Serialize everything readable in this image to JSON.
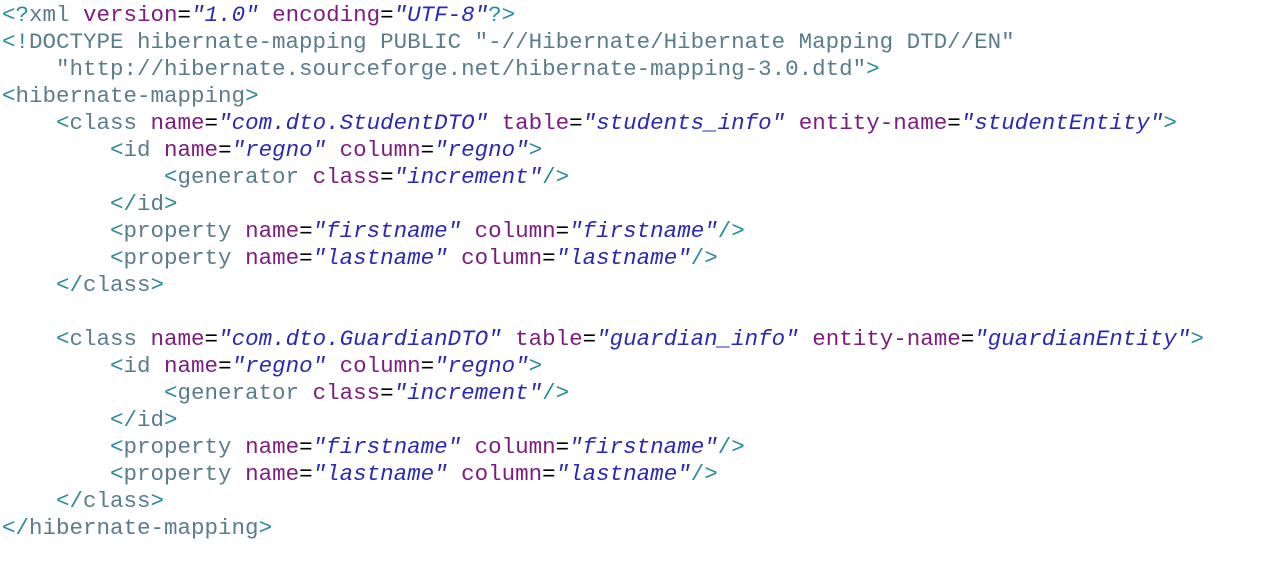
{
  "colors": {
    "background": "#ffffff",
    "bracket": "#2a8b9a",
    "tag": "#5a7d8c",
    "attr": "#7d1b7e",
    "string": "#2929b8",
    "text": "#000000"
  },
  "lines": [
    [
      {
        "t": "<?",
        "c": "bracket"
      },
      {
        "t": "xml ",
        "c": "tag"
      },
      {
        "t": "version",
        "c": "attr"
      },
      {
        "t": "=",
        "c": "text"
      },
      {
        "t": "\"1.0\"",
        "c": "string",
        "i": true
      },
      {
        "t": " ",
        "c": "text"
      },
      {
        "t": "encoding",
        "c": "attr"
      },
      {
        "t": "=",
        "c": "text"
      },
      {
        "t": "\"UTF-8\"",
        "c": "string",
        "i": true
      },
      {
        "t": "?>",
        "c": "bracket"
      }
    ],
    [
      {
        "t": "<!",
        "c": "bracket"
      },
      {
        "t": "DOCTYPE hibernate-mapping PUBLIC ",
        "c": "tag"
      },
      {
        "t": "\"-//Hibernate/Hibernate Mapping DTD//EN\"",
        "c": "tag"
      }
    ],
    [
      {
        "t": "    \"http://hibernate.sourceforge.net/hibernate-mapping-3.0.dtd\"",
        "c": "tag"
      },
      {
        "t": ">",
        "c": "bracket"
      }
    ],
    [
      {
        "t": "<",
        "c": "bracket"
      },
      {
        "t": "hibernate-mapping",
        "c": "tag"
      },
      {
        "t": ">",
        "c": "bracket"
      }
    ],
    [
      {
        "t": "    <",
        "c": "bracket"
      },
      {
        "t": "class ",
        "c": "tag"
      },
      {
        "t": "name",
        "c": "attr"
      },
      {
        "t": "=",
        "c": "text"
      },
      {
        "t": "\"com.dto.StudentDTO\"",
        "c": "string",
        "i": true
      },
      {
        "t": " ",
        "c": "text"
      },
      {
        "t": "table",
        "c": "attr"
      },
      {
        "t": "=",
        "c": "text"
      },
      {
        "t": "\"students_info\"",
        "c": "string",
        "i": true
      },
      {
        "t": " ",
        "c": "text"
      },
      {
        "t": "entity-name",
        "c": "attr"
      },
      {
        "t": "=",
        "c": "text"
      },
      {
        "t": "\"studentEntity\"",
        "c": "string",
        "i": true
      },
      {
        "t": ">",
        "c": "bracket"
      }
    ],
    [
      {
        "t": "        <",
        "c": "bracket"
      },
      {
        "t": "id ",
        "c": "tag"
      },
      {
        "t": "name",
        "c": "attr"
      },
      {
        "t": "=",
        "c": "text"
      },
      {
        "t": "\"regno\"",
        "c": "string",
        "i": true
      },
      {
        "t": " ",
        "c": "text"
      },
      {
        "t": "column",
        "c": "attr"
      },
      {
        "t": "=",
        "c": "text"
      },
      {
        "t": "\"regno\"",
        "c": "string",
        "i": true
      },
      {
        "t": ">",
        "c": "bracket"
      }
    ],
    [
      {
        "t": "            <",
        "c": "bracket"
      },
      {
        "t": "generator ",
        "c": "tag"
      },
      {
        "t": "class",
        "c": "attr"
      },
      {
        "t": "=",
        "c": "text"
      },
      {
        "t": "\"increment\"",
        "c": "string",
        "i": true
      },
      {
        "t": "/>",
        "c": "bracket"
      }
    ],
    [
      {
        "t": "        </",
        "c": "bracket"
      },
      {
        "t": "id",
        "c": "tag"
      },
      {
        "t": ">",
        "c": "bracket"
      }
    ],
    [
      {
        "t": "        <",
        "c": "bracket"
      },
      {
        "t": "property ",
        "c": "tag"
      },
      {
        "t": "name",
        "c": "attr"
      },
      {
        "t": "=",
        "c": "text"
      },
      {
        "t": "\"firstname\"",
        "c": "string",
        "i": true
      },
      {
        "t": " ",
        "c": "text"
      },
      {
        "t": "column",
        "c": "attr"
      },
      {
        "t": "=",
        "c": "text"
      },
      {
        "t": "\"firstname\"",
        "c": "string",
        "i": true
      },
      {
        "t": "/>",
        "c": "bracket"
      }
    ],
    [
      {
        "t": "        <",
        "c": "bracket"
      },
      {
        "t": "property ",
        "c": "tag"
      },
      {
        "t": "name",
        "c": "attr"
      },
      {
        "t": "=",
        "c": "text"
      },
      {
        "t": "\"lastname\"",
        "c": "string",
        "i": true
      },
      {
        "t": " ",
        "c": "text"
      },
      {
        "t": "column",
        "c": "attr"
      },
      {
        "t": "=",
        "c": "text"
      },
      {
        "t": "\"lastname\"",
        "c": "string",
        "i": true
      },
      {
        "t": "/>",
        "c": "bracket"
      }
    ],
    [
      {
        "t": "    </",
        "c": "bracket"
      },
      {
        "t": "class",
        "c": "tag"
      },
      {
        "t": ">",
        "c": "bracket"
      }
    ],
    [],
    [
      {
        "t": "    <",
        "c": "bracket"
      },
      {
        "t": "class ",
        "c": "tag"
      },
      {
        "t": "name",
        "c": "attr"
      },
      {
        "t": "=",
        "c": "text"
      },
      {
        "t": "\"com.dto.GuardianDTO\"",
        "c": "string",
        "i": true
      },
      {
        "t": " ",
        "c": "text"
      },
      {
        "t": "table",
        "c": "attr"
      },
      {
        "t": "=",
        "c": "text"
      },
      {
        "t": "\"guardian_info\"",
        "c": "string",
        "i": true
      },
      {
        "t": " ",
        "c": "text"
      },
      {
        "t": "entity-name",
        "c": "attr"
      },
      {
        "t": "=",
        "c": "text"
      },
      {
        "t": "\"guardianEntity\"",
        "c": "string",
        "i": true
      },
      {
        "t": ">",
        "c": "bracket"
      }
    ],
    [
      {
        "t": "        <",
        "c": "bracket"
      },
      {
        "t": "id ",
        "c": "tag"
      },
      {
        "t": "name",
        "c": "attr"
      },
      {
        "t": "=",
        "c": "text"
      },
      {
        "t": "\"regno\"",
        "c": "string",
        "i": true
      },
      {
        "t": " ",
        "c": "text"
      },
      {
        "t": "column",
        "c": "attr"
      },
      {
        "t": "=",
        "c": "text"
      },
      {
        "t": "\"regno\"",
        "c": "string",
        "i": true
      },
      {
        "t": ">",
        "c": "bracket"
      }
    ],
    [
      {
        "t": "            <",
        "c": "bracket"
      },
      {
        "t": "generator ",
        "c": "tag"
      },
      {
        "t": "class",
        "c": "attr"
      },
      {
        "t": "=",
        "c": "text"
      },
      {
        "t": "\"increment\"",
        "c": "string",
        "i": true
      },
      {
        "t": "/>",
        "c": "bracket"
      }
    ],
    [
      {
        "t": "        </",
        "c": "bracket"
      },
      {
        "t": "id",
        "c": "tag"
      },
      {
        "t": ">",
        "c": "bracket"
      }
    ],
    [
      {
        "t": "        <",
        "c": "bracket"
      },
      {
        "t": "property ",
        "c": "tag"
      },
      {
        "t": "name",
        "c": "attr"
      },
      {
        "t": "=",
        "c": "text"
      },
      {
        "t": "\"firstname\"",
        "c": "string",
        "i": true
      },
      {
        "t": " ",
        "c": "text"
      },
      {
        "t": "column",
        "c": "attr"
      },
      {
        "t": "=",
        "c": "text"
      },
      {
        "t": "\"firstname\"",
        "c": "string",
        "i": true
      },
      {
        "t": "/>",
        "c": "bracket"
      }
    ],
    [
      {
        "t": "        <",
        "c": "bracket"
      },
      {
        "t": "property ",
        "c": "tag"
      },
      {
        "t": "name",
        "c": "attr"
      },
      {
        "t": "=",
        "c": "text"
      },
      {
        "t": "\"lastname\"",
        "c": "string",
        "i": true
      },
      {
        "t": " ",
        "c": "text"
      },
      {
        "t": "column",
        "c": "attr"
      },
      {
        "t": "=",
        "c": "text"
      },
      {
        "t": "\"lastname\"",
        "c": "string",
        "i": true
      },
      {
        "t": "/>",
        "c": "bracket"
      }
    ],
    [
      {
        "t": "    </",
        "c": "bracket"
      },
      {
        "t": "class",
        "c": "tag"
      },
      {
        "t": ">",
        "c": "bracket"
      }
    ],
    [
      {
        "t": "</",
        "c": "bracket"
      },
      {
        "t": "hibernate-mapping",
        "c": "tag"
      },
      {
        "t": ">",
        "c": "bracket"
      }
    ]
  ]
}
